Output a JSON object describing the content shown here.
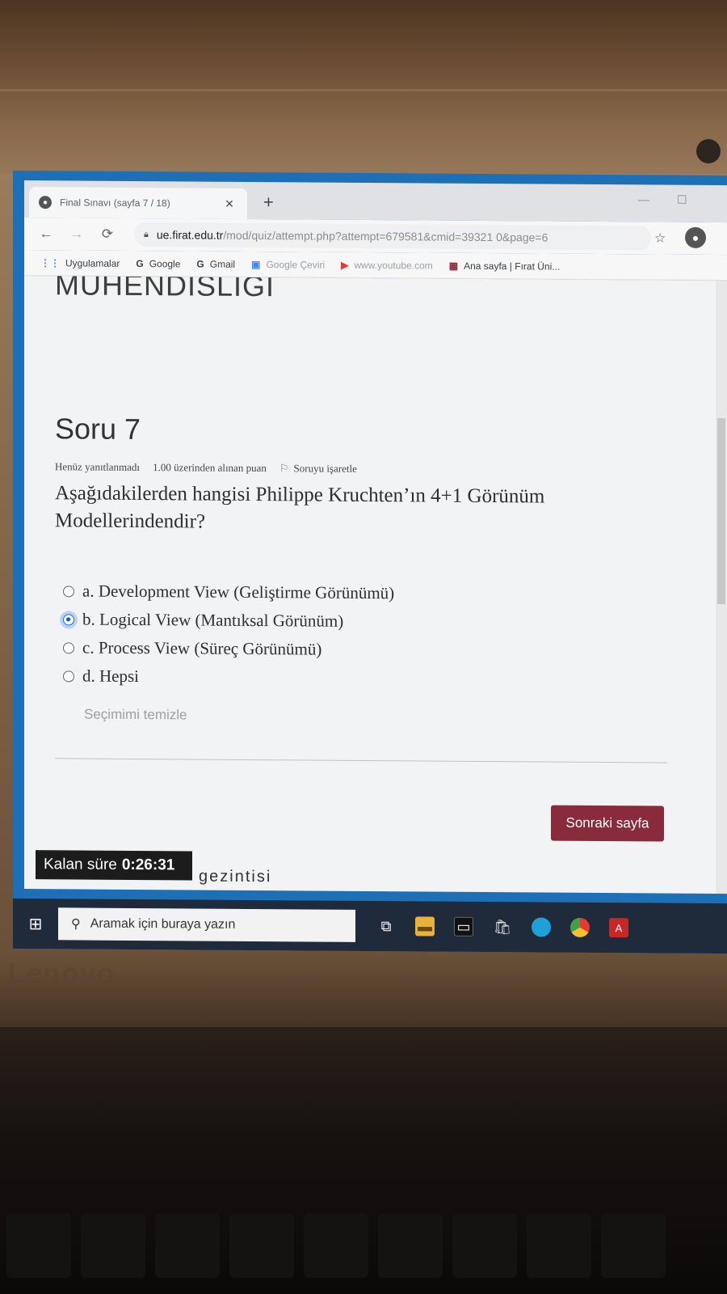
{
  "browser": {
    "tab_title": "Final Sınavı (sayfa 7 / 18)",
    "tab_close": "×",
    "new_tab": "+",
    "url_host": "ue.firat.edu.tr",
    "url_path": "/mod/quiz/attempt.php?attempt=679581&cmid=39321 0&page=6"
  },
  "bookmarks": [
    {
      "icon": "apps-icon",
      "glyph": "⋮⋮",
      "label": "Uygulamalar"
    },
    {
      "icon": "google-icon",
      "glyph": "G",
      "label": "Google"
    },
    {
      "icon": "google-icon",
      "glyph": "G",
      "label": "Gmail"
    },
    {
      "icon": "translate-icon",
      "glyph": "▣",
      "label": "Google Çeviri"
    },
    {
      "icon": "youtube-icon",
      "glyph": "▶",
      "label": "www.youtube.com"
    },
    {
      "icon": "site-icon",
      "glyph": "▦",
      "label": "Ana sayfa | Fırat Üni..."
    }
  ],
  "page": {
    "course_title": "MÜHENDİSLİĞİ",
    "question_number": "Soru 7",
    "status": "Henüz yanıtlanmadı",
    "points": "1.00 üzerinden alınan puan",
    "flag_label": "Soruyu işaretle",
    "question_text": "Aşağıdakilerden hangisi Philippe Kruchten’ın 4+1 Görünüm Modellerindendir?",
    "answers": [
      {
        "label": "a. Development View (Geliştirme Görünümü)",
        "checked": false
      },
      {
        "label": "b. Logical View (Mantıksal Görünüm)",
        "checked": true
      },
      {
        "label": "c. Process View (Süreç Görünümü)",
        "checked": false
      },
      {
        "label": "d. Hepsi",
        "checked": false
      }
    ],
    "clear_choice": "Seçimimi temizle",
    "next_button": "Sonraki sayfa",
    "timer_label": "Kalan süre",
    "timer_value": "0:26:31",
    "cut_off_text": "gezintisi"
  },
  "taskbar": {
    "search_placeholder": "Aramak için buraya yazın"
  },
  "laptop": {
    "brand": "Lenovo"
  },
  "colors": {
    "next_button": "#8a2b3b",
    "desktop_blue": "#1d6fb6",
    "taskbar": "#1f2a3a"
  }
}
